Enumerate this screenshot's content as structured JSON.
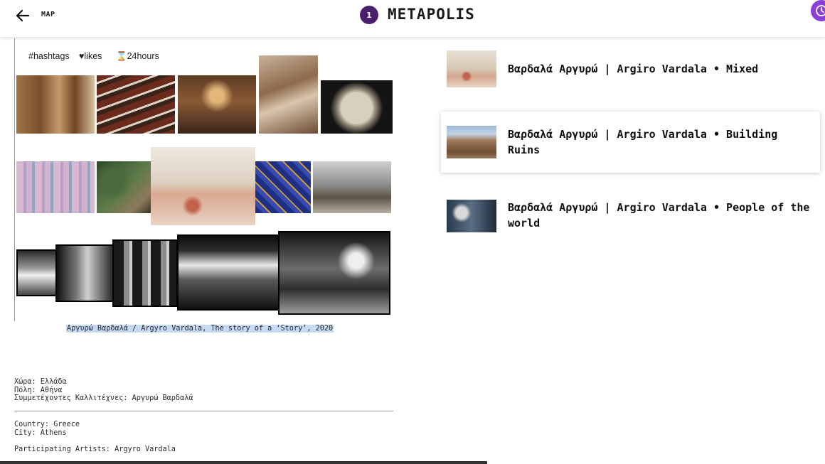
{
  "header": {
    "back_icon": "arrow-left-icon",
    "map_label": "MAP",
    "badge_count": "1",
    "title": "METAPOLIS",
    "clock_icon": "clock-icon",
    "accent_color": "#8b3fd9",
    "badge_color": "#4a1f6e"
  },
  "filters": {
    "hashtags": "#hashtags",
    "likes": "♥likes",
    "hours": "⌛24hours"
  },
  "gallery": {
    "caption": "Αργυρώ Βαρδαλά / Argyro Vardala, The story of a ‘Story’, 2020"
  },
  "info_greek": {
    "country": "Χώρα: Ελλάδα",
    "city": "Πόλη: Αθήνα",
    "artists": "Συμμετέχοντες Καλλιτέχνες: Αργυρώ Βαρδαλά"
  },
  "info_english": {
    "country": "Country: Greece",
    "city": "City: Athens",
    "artists": "Participating Artists: Argyro Vardala"
  },
  "results": [
    {
      "title": "Βαρδαλά Αργυρώ | Argiro Vardala • Mixed"
    },
    {
      "title": "Βαρδαλά Αργυρώ | Argiro Vardala • Building Ruins"
    },
    {
      "title": "Βαρδαλά Αργυρώ | Argiro Vardala • People of the world"
    }
  ]
}
